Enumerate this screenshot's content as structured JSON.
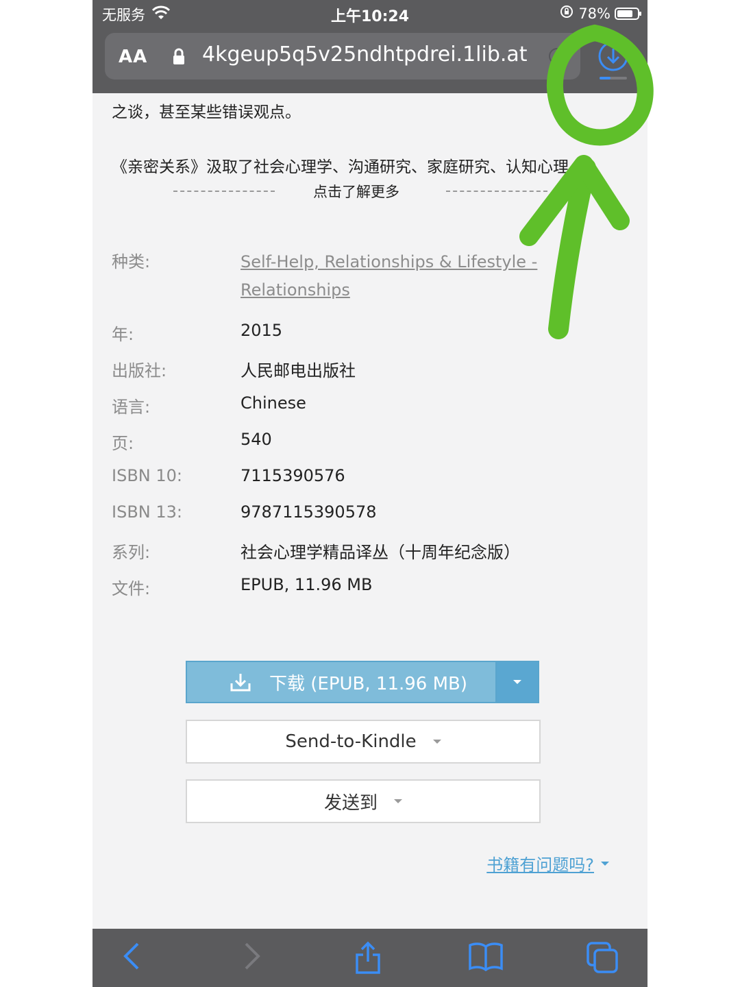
{
  "status_bar": {
    "carrier": "无服务",
    "time": "上午10:24",
    "battery": "78%",
    "icons": [
      "wifi-icon",
      "rotation-lock-icon",
      "battery-icon"
    ]
  },
  "browser": {
    "aa_label": "AA",
    "url": "4kgeup5q5v25ndhtpdrei.1lib.at",
    "icons": [
      "lock-icon",
      "reload-icon",
      "download-icon"
    ],
    "download_progress": 0.4
  },
  "content": {
    "desc_line1": "之谈，甚至某些错误观点。",
    "desc_line2": "《亲密关系》汲取了社会心理学、沟通研究、家庭研究、认知心理",
    "more_label": "点击了解更多",
    "details": [
      {
        "key": "种类:",
        "value_line1": "Self-Help, Relationships & Lifestyle -",
        "value_line2": "Relationships"
      },
      {
        "key": "年:",
        "value": "2015"
      },
      {
        "key": "出版社:",
        "value": "人民邮电出版社"
      },
      {
        "key": "语言:",
        "value": "Chinese"
      },
      {
        "key": "页:",
        "value": "540"
      },
      {
        "key": "ISBN 10:",
        "value": "7115390576"
      },
      {
        "key": "ISBN 13:",
        "value": "9787115390578"
      },
      {
        "key": "系列:",
        "value": "社会心理学精品译丛（十周年纪念版）"
      },
      {
        "key": "文件:",
        "value": "EPUB, 11.96 MB"
      }
    ],
    "download_button": "下载 (EPUB, 11.96 MB)",
    "kindle_button": "Send-to-Kindle",
    "send_button": "发送到",
    "problem_link": "书籍有问题吗?"
  },
  "bottom_bar": {
    "icons": [
      "back-icon",
      "forward-icon",
      "share-icon",
      "bookmarks-icon",
      "tabs-icon"
    ]
  },
  "colors": {
    "accent_blue": "#3b8df5",
    "download_button": "#7fbcda",
    "annotation_green": "#5fbf2a"
  }
}
